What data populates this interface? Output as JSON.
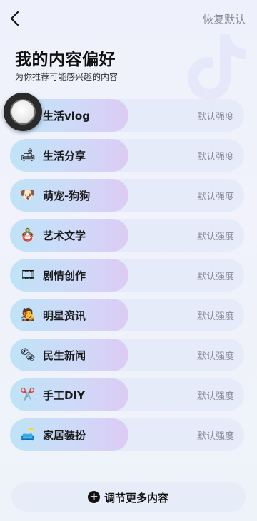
{
  "header": {
    "back_icon": "chevron-left-icon",
    "restore_label": "恢复默认"
  },
  "page": {
    "title": "我的内容偏好",
    "subtitle": "为你推荐可能感兴趣的内容"
  },
  "preferences": [
    {
      "icon": "",
      "label": "生活vlog",
      "strength": "默认强度"
    },
    {
      "icon": "🛋",
      "label": "生活分享",
      "strength": "默认强度"
    },
    {
      "icon": "🐶",
      "label": "萌宠-狗狗",
      "strength": "默认强度"
    },
    {
      "icon": "🪆",
      "label": "艺术文学",
      "strength": "默认强度"
    },
    {
      "icon": "🎞",
      "label": "剧情创作",
      "strength": "默认强度"
    },
    {
      "icon": "🧑‍🎤",
      "label": "明星资讯",
      "strength": "默认强度"
    },
    {
      "icon": "🗞",
      "label": "民生新闻",
      "strength": "默认强度"
    },
    {
      "icon": "✂️",
      "label": "手工DIY",
      "strength": "默认强度"
    },
    {
      "icon": "🛋️",
      "label": "家居装扮",
      "strength": "默认强度"
    }
  ],
  "footer": {
    "add_icon": "plus-circle-icon",
    "more_label": "调节更多内容"
  },
  "colors": {
    "accent_pill_start": "#bfe3f7",
    "accent_pill_end": "#dccbf4",
    "muted_text": "#8a8d96"
  }
}
